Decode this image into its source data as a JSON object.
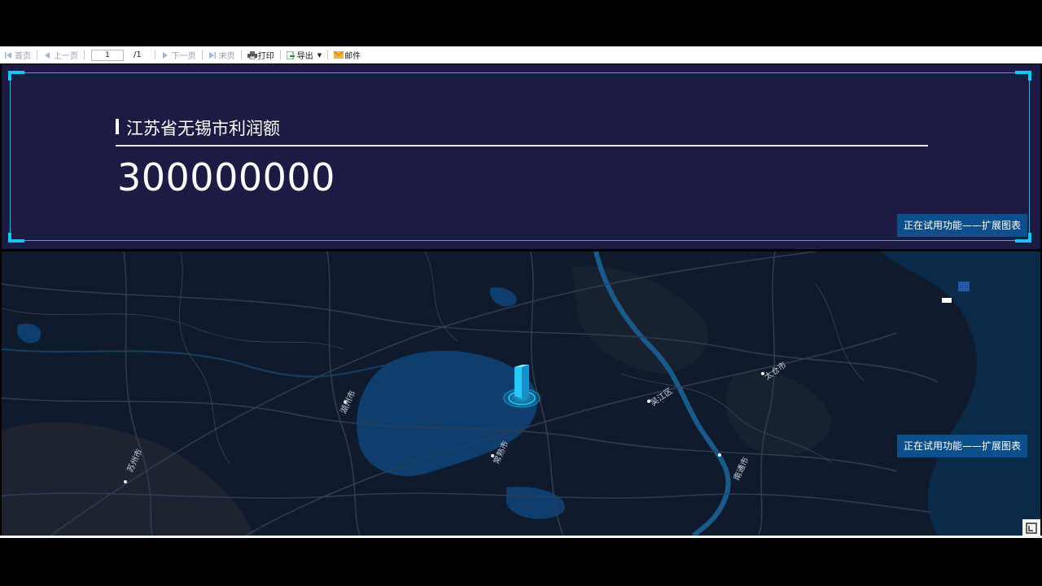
{
  "toolbar": {
    "first": "首页",
    "prev": "上一页",
    "page_value": "1",
    "page_total": "/1",
    "next": "下一页",
    "last": "末页",
    "print": "打印",
    "export": "导出",
    "mail": "邮件"
  },
  "panel": {
    "title": "江苏省无锡市利润额",
    "value": "300000000",
    "trial_badge": "正在试用功能——扩展图表"
  },
  "map": {
    "trial_badge": "正在试用功能——扩展图表",
    "cities": [
      {
        "name": "苏州市"
      },
      {
        "name": "湖州市"
      },
      {
        "name": "常熟市"
      },
      {
        "name": "南通市"
      },
      {
        "name": "吴江区"
      },
      {
        "name": "太仓市"
      }
    ]
  },
  "colors": {
    "panel_bg": "#1b1b44",
    "frame_accent": "#15c5f5",
    "badge_bg": "#0b4f8d",
    "map_bg": "#0f1a2c",
    "lake": "#0d3e6e",
    "bar": "#25c8f7"
  }
}
